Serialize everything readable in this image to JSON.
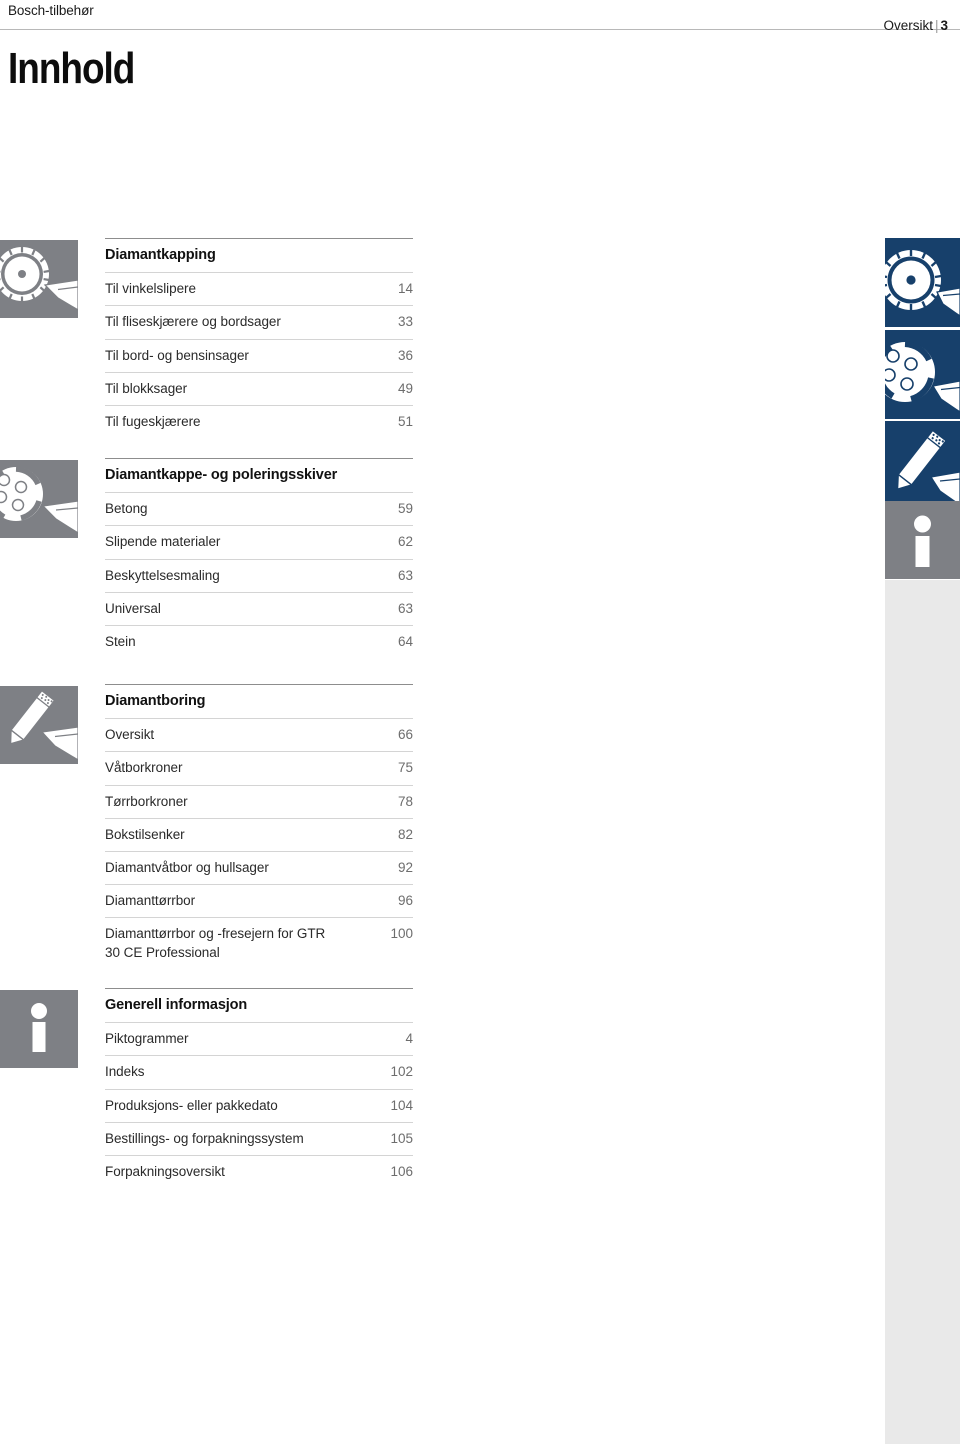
{
  "header": {
    "left_text": "Bosch-tilbehør",
    "right_label": "Oversikt",
    "right_separator": "|",
    "right_page": "3"
  },
  "title": "Innhold",
  "colors": {
    "tab_blue": "#17406b",
    "tab_grey": "#7e8085",
    "rail_background": "#e9e9e9",
    "rule_dark": "#8d8d8d",
    "rule_light": "#d4d4d4",
    "page_number_text": "#6d6d6d"
  },
  "tabs": [
    {
      "name": "diamond-blade-tab",
      "style": "blue"
    },
    {
      "name": "diamond-cup-wheel-tab",
      "style": "blue"
    },
    {
      "name": "diamond-drill-tab",
      "style": "blue"
    },
    {
      "name": "general-information-tab",
      "style": "grey",
      "glyph": "i"
    }
  ],
  "sections": [
    {
      "icon_name": "diamond-saw-blade-icon",
      "heading": "Diamantkapping",
      "rows": [
        {
          "label": "Til vinkelslipere",
          "page": "14"
        },
        {
          "label": "Til fliseskjærere og bordsager",
          "page": "33"
        },
        {
          "label": "Til bord- og bensinsager",
          "page": "36"
        },
        {
          "label": "Til blokksager",
          "page": "49"
        },
        {
          "label": "Til fugeskjærere",
          "page": "51"
        }
      ]
    },
    {
      "icon_name": "diamond-cup-wheel-icon",
      "heading": "Diamantkappe- og poleringsskiver",
      "rows": [
        {
          "label": "Betong",
          "page": "59"
        },
        {
          "label": "Slipende materialer",
          "page": "62"
        },
        {
          "label": "Beskyttelsesmaling",
          "page": "63"
        },
        {
          "label": "Universal",
          "page": "63"
        },
        {
          "label": "Stein",
          "page": "64"
        }
      ]
    },
    {
      "icon_name": "diamond-drill-bit-icon",
      "heading": "Diamantboring",
      "rows": [
        {
          "label": "Oversikt",
          "page": "66"
        },
        {
          "label": "Våtborkroner",
          "page": "75"
        },
        {
          "label": "Tørrborkroner",
          "page": "78"
        },
        {
          "label": "Bokstilsenker",
          "page": "82"
        },
        {
          "label": "Diamantvåtbor og hullsager",
          "page": "92"
        },
        {
          "label": "Diamanttørrbor",
          "page": "96"
        },
        {
          "label": "Diamanttørrbor og -fresejern for GTR 30 CE Professional",
          "page": "100"
        }
      ]
    },
    {
      "icon_name": "information-icon",
      "heading": "Generell informasjon",
      "rows": [
        {
          "label": "Piktogrammer",
          "page": "4"
        },
        {
          "label": "Indeks",
          "page": "102"
        },
        {
          "label": "Produksjons- eller pakkedato",
          "page": "104"
        },
        {
          "label": "Bestillings- og forpakningssystem",
          "page": "105"
        },
        {
          "label": "Forpakningsoversikt",
          "page": "106"
        }
      ]
    }
  ]
}
